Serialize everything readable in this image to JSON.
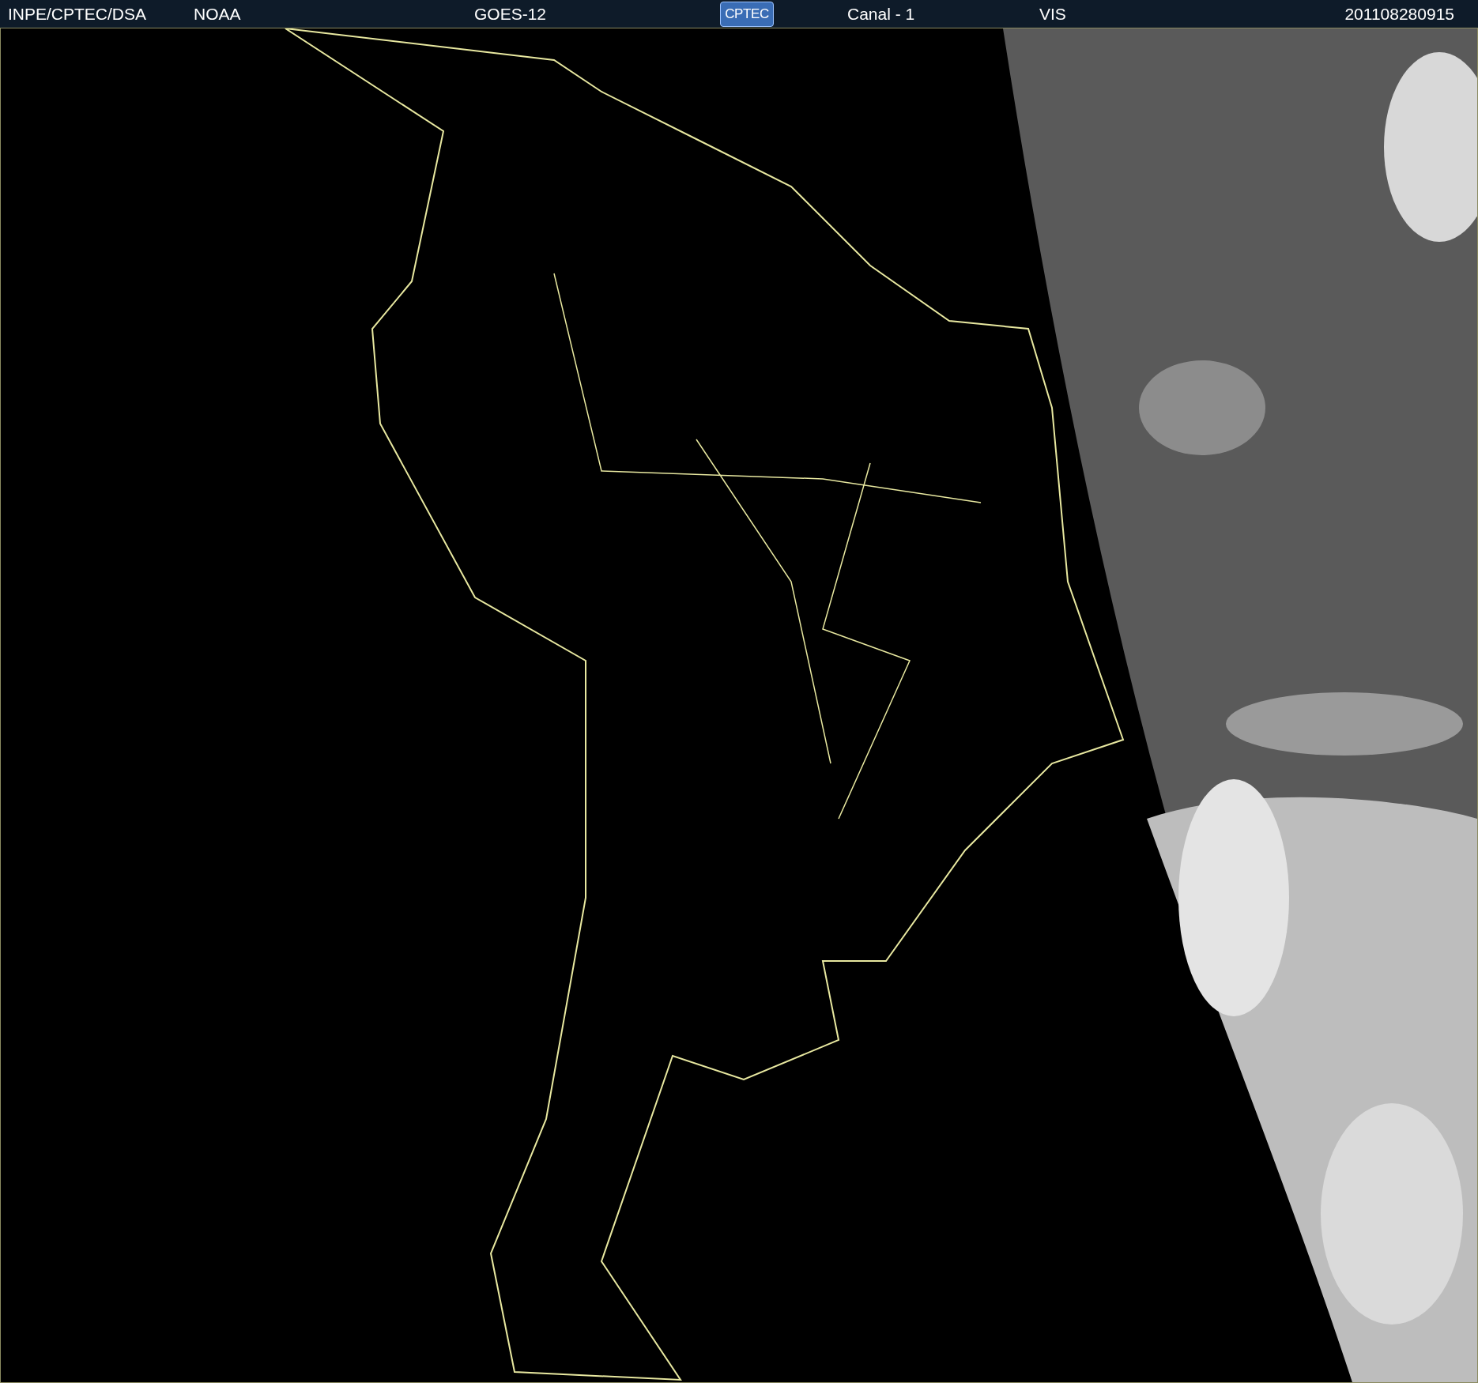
{
  "header": {
    "items": [
      {
        "kind": "text",
        "label": "INPE/CPTEC/DSA"
      },
      {
        "kind": "text",
        "label": "NOAA"
      },
      {
        "kind": "text",
        "label": "GOES-12"
      },
      {
        "kind": "logo",
        "label": "CPTEC"
      },
      {
        "kind": "text",
        "label": "Canal - 1"
      },
      {
        "kind": "text",
        "label": "VIS"
      },
      {
        "kind": "text",
        "label": "201108280915"
      }
    ]
  }
}
